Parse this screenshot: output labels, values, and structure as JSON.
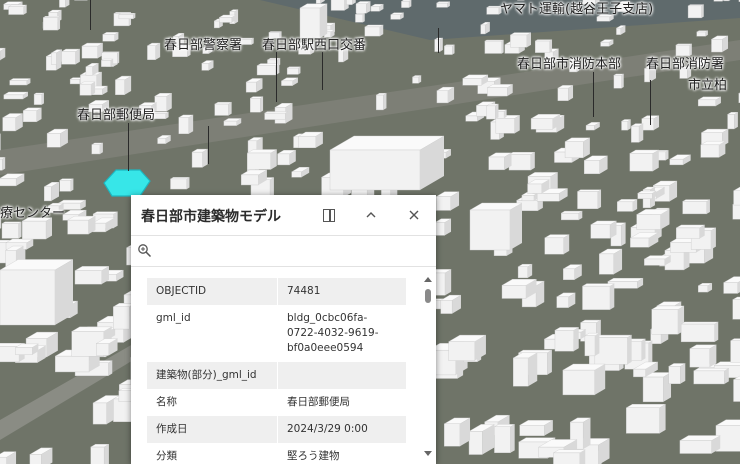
{
  "map": {
    "labels": [
      {
        "id": "yamato",
        "text": "ヤマト運輸(越谷王子支店)"
      },
      {
        "id": "police",
        "text": "春日部警察署"
      },
      {
        "id": "station-west",
        "text": "春日部駅西口交番"
      },
      {
        "id": "fire-hq",
        "text": "春日部市消防本部"
      },
      {
        "id": "fire-station",
        "text": "春日部消防署"
      },
      {
        "id": "shiritsu",
        "text": "市立柏"
      },
      {
        "id": "post-office",
        "text": "春日部郵便局"
      },
      {
        "id": "medical",
        "text": "療センター"
      }
    ],
    "colors": {
      "ground": "#6f7468",
      "building": "#f2f2f2",
      "selection": "#37e6e8"
    }
  },
  "popup": {
    "title": "春日部市建築物モデル",
    "dock_icon": "dock-panel-icon",
    "collapse_icon": "chevron-up-icon",
    "close_icon": "close-icon",
    "zoom_icon": "zoom-to-icon",
    "attributes": [
      {
        "key": "OBJECTID",
        "value": "74481"
      },
      {
        "key": "gml_id",
        "value": "bldg_0cbc06fa-0722-4032-9619-bf0a0eee0594"
      },
      {
        "key": "建築物(部分)_gml_id",
        "value": ""
      },
      {
        "key": "名称",
        "value": "春日部郵便局"
      },
      {
        "key": "作成日",
        "value": "2024/3/29 0:00"
      },
      {
        "key": "分類",
        "value": "堅ろう建物"
      }
    ]
  }
}
